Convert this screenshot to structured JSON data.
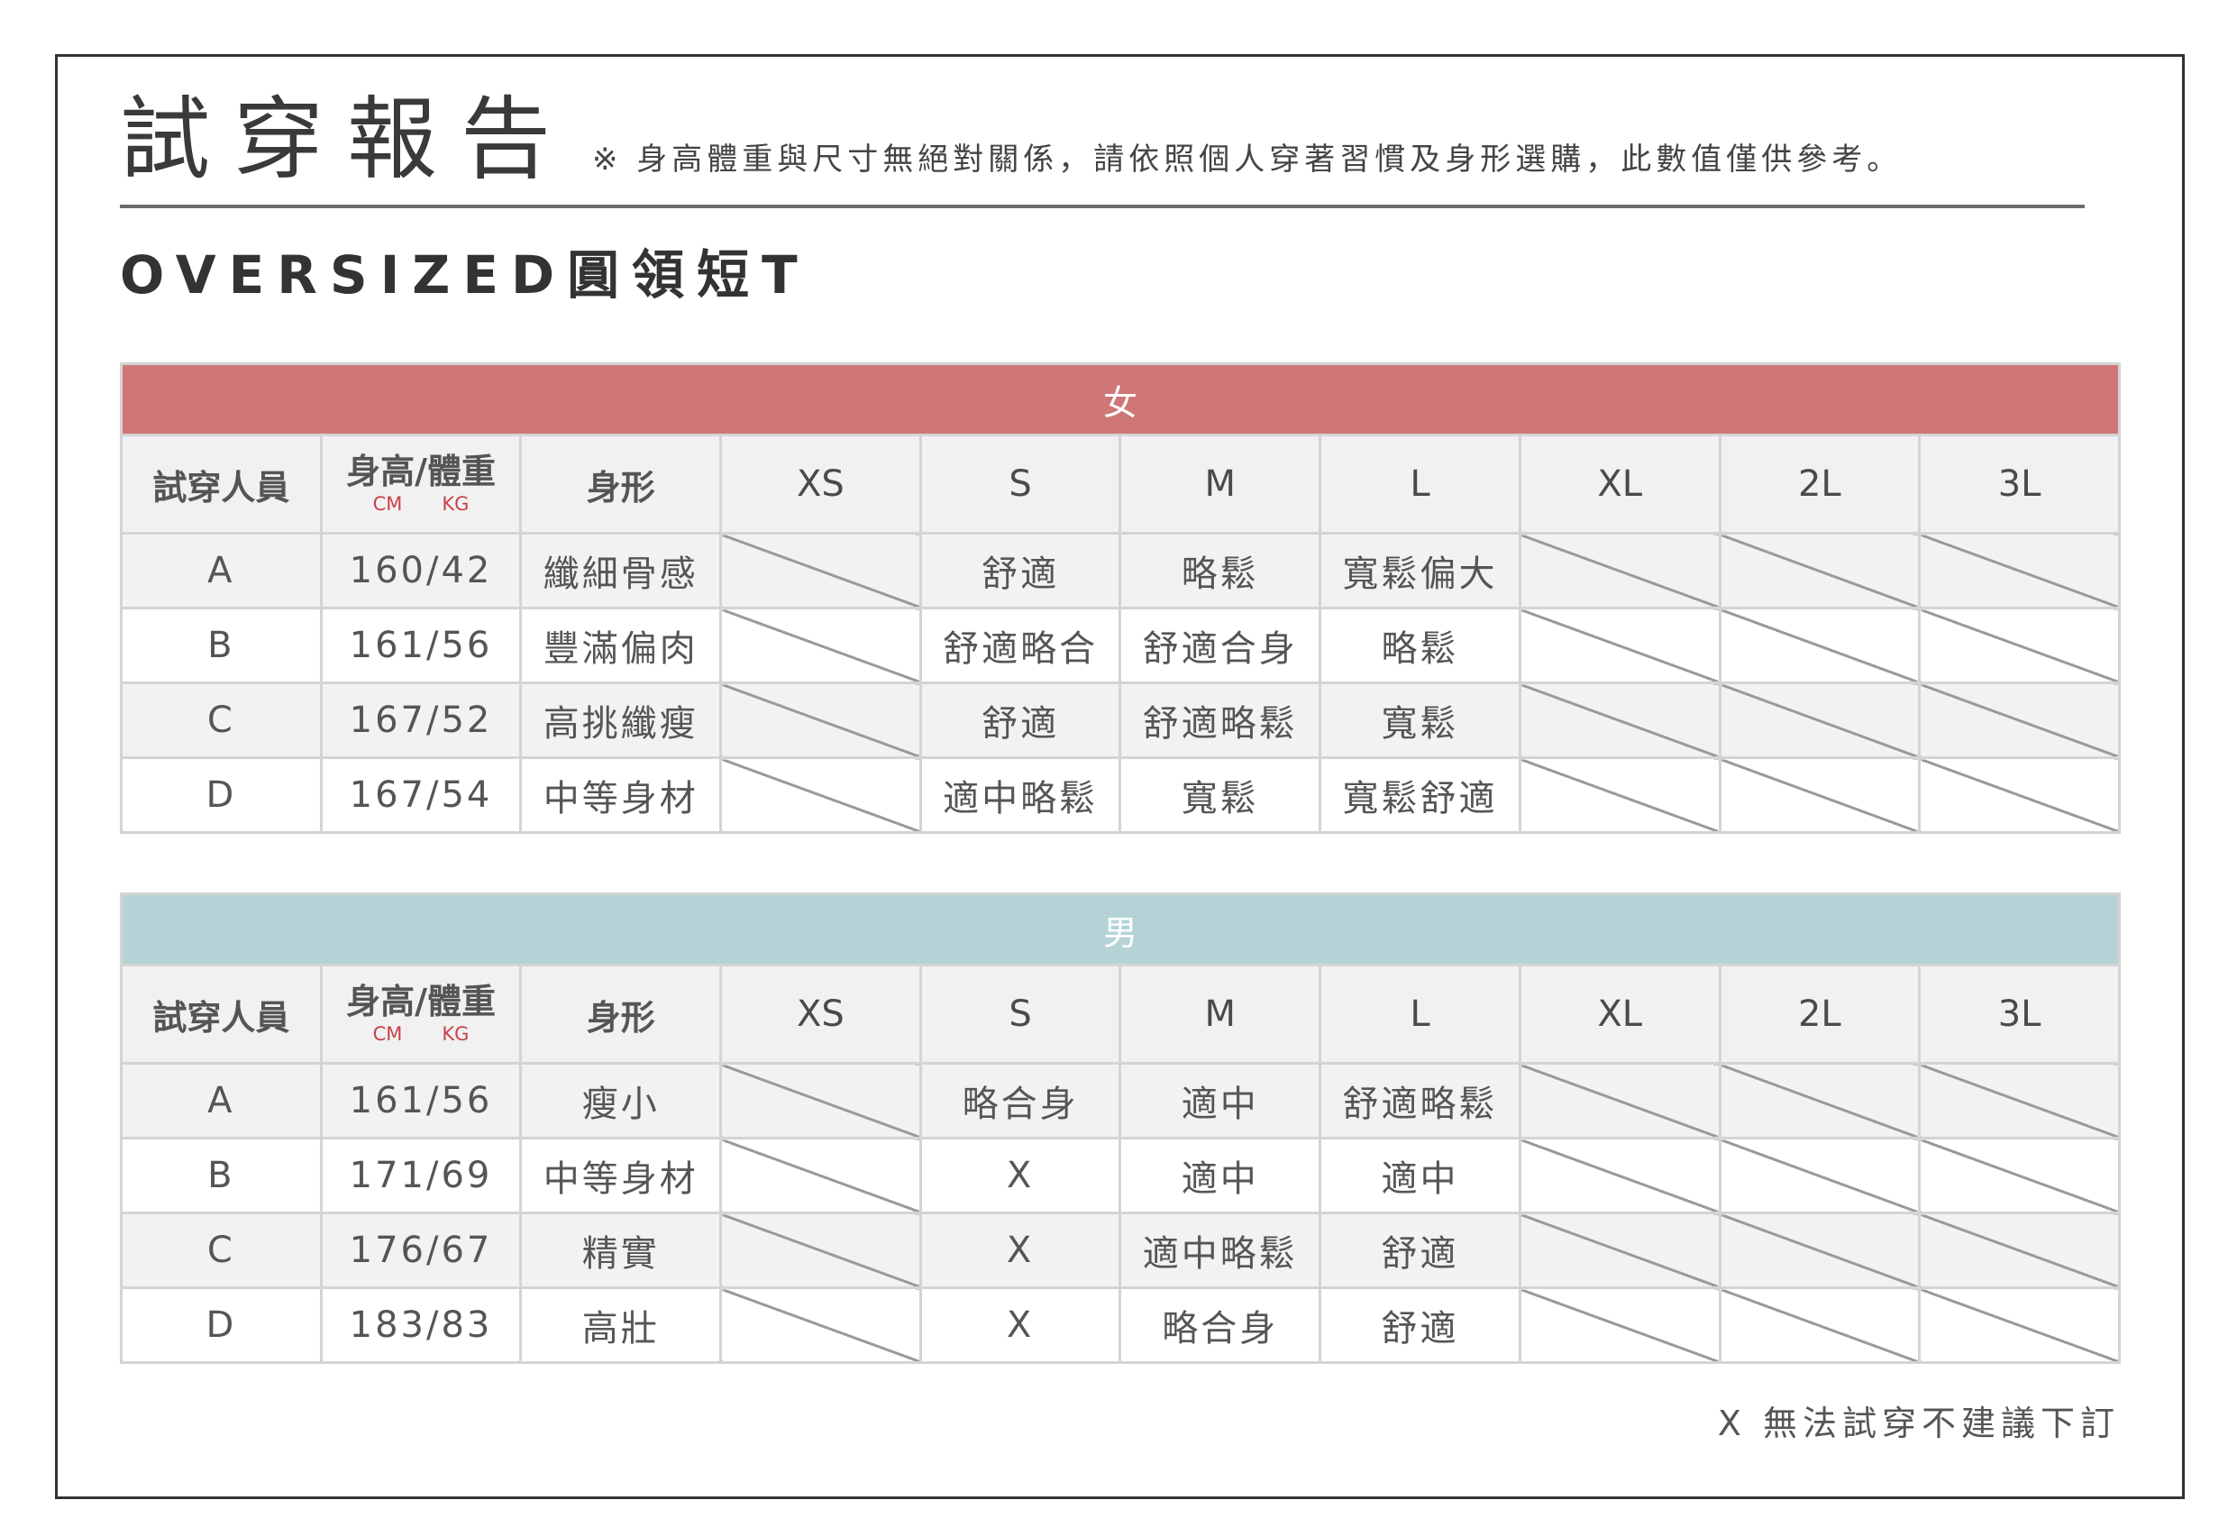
{
  "title": "試穿報告",
  "note": "※ 身高體重與尺寸無絕對關係，請依照個人穿著習慣及身形選購，此數值僅供參考。",
  "subtitle": "OVERSIZED圓領短T",
  "colors": {
    "female_band": "#cf7777",
    "male_band": "#b5d3d6"
  },
  "headers": {
    "tester": "試穿人員",
    "hw": "身高/體重",
    "unit_cm": "CM",
    "unit_kg": "KG",
    "body": "身形",
    "sizes": [
      "XS",
      "S",
      "M",
      "L",
      "XL",
      "2L",
      "3L"
    ]
  },
  "female": {
    "label": "女",
    "rows": [
      {
        "id": "A",
        "hw": "160/42",
        "body": "纖細骨感",
        "fit": [
          "",
          "舒適",
          "略鬆",
          "寬鬆偏大",
          "",
          "",
          ""
        ]
      },
      {
        "id": "B",
        "hw": "161/56",
        "body": "豐滿偏肉",
        "fit": [
          "",
          "舒適略合",
          "舒適合身",
          "略鬆",
          "",
          "",
          ""
        ]
      },
      {
        "id": "C",
        "hw": "167/52",
        "body": "高挑纖瘦",
        "fit": [
          "",
          "舒適",
          "舒適略鬆",
          "寬鬆",
          "",
          "",
          ""
        ]
      },
      {
        "id": "D",
        "hw": "167/54",
        "body": "中等身材",
        "fit": [
          "",
          "適中略鬆",
          "寬鬆",
          "寬鬆舒適",
          "",
          "",
          ""
        ]
      }
    ]
  },
  "male": {
    "label": "男",
    "rows": [
      {
        "id": "A",
        "hw": "161/56",
        "body": "瘦小",
        "fit": [
          "",
          "略合身",
          "適中",
          "舒適略鬆",
          "",
          "",
          ""
        ]
      },
      {
        "id": "B",
        "hw": "171/69",
        "body": "中等身材",
        "fit": [
          "",
          "X",
          "適中",
          "適中",
          "",
          "",
          ""
        ]
      },
      {
        "id": "C",
        "hw": "176/67",
        "body": "精實",
        "fit": [
          "",
          "X",
          "適中略鬆",
          "舒適",
          "",
          "",
          ""
        ]
      },
      {
        "id": "D",
        "hw": "183/83",
        "body": "高壯",
        "fit": [
          "",
          "X",
          "略合身",
          "舒適",
          "",
          "",
          ""
        ]
      }
    ]
  },
  "footer_note": "X 無法試穿不建議下訂"
}
